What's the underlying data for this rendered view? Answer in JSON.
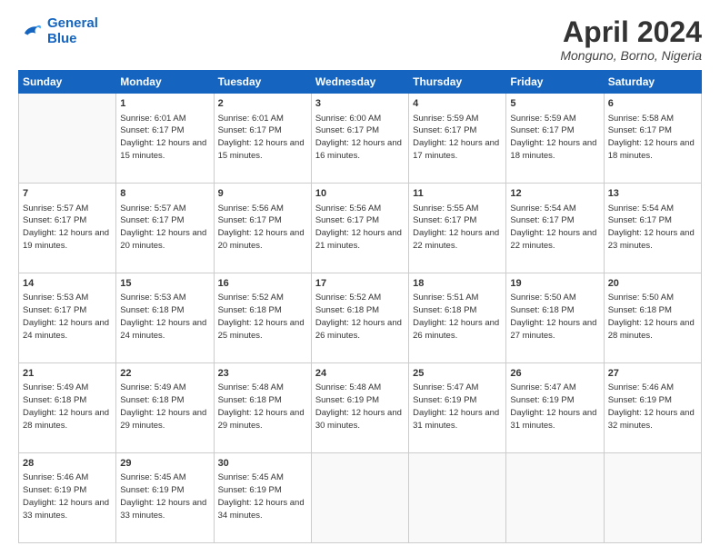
{
  "logo": {
    "line1": "General",
    "line2": "Blue"
  },
  "title": "April 2024",
  "location": "Monguno, Borno, Nigeria",
  "weekdays": [
    "Sunday",
    "Monday",
    "Tuesday",
    "Wednesday",
    "Thursday",
    "Friday",
    "Saturday"
  ],
  "weeks": [
    [
      {
        "day": null,
        "sunrise": null,
        "sunset": null,
        "daylight": null
      },
      {
        "day": "1",
        "sunrise": "6:01 AM",
        "sunset": "6:17 PM",
        "daylight": "12 hours and 15 minutes."
      },
      {
        "day": "2",
        "sunrise": "6:01 AM",
        "sunset": "6:17 PM",
        "daylight": "12 hours and 15 minutes."
      },
      {
        "day": "3",
        "sunrise": "6:00 AM",
        "sunset": "6:17 PM",
        "daylight": "12 hours and 16 minutes."
      },
      {
        "day": "4",
        "sunrise": "5:59 AM",
        "sunset": "6:17 PM",
        "daylight": "12 hours and 17 minutes."
      },
      {
        "day": "5",
        "sunrise": "5:59 AM",
        "sunset": "6:17 PM",
        "daylight": "12 hours and 18 minutes."
      },
      {
        "day": "6",
        "sunrise": "5:58 AM",
        "sunset": "6:17 PM",
        "daylight": "12 hours and 18 minutes."
      }
    ],
    [
      {
        "day": "7",
        "sunrise": "5:57 AM",
        "sunset": "6:17 PM",
        "daylight": "12 hours and 19 minutes."
      },
      {
        "day": "8",
        "sunrise": "5:57 AM",
        "sunset": "6:17 PM",
        "daylight": "12 hours and 20 minutes."
      },
      {
        "day": "9",
        "sunrise": "5:56 AM",
        "sunset": "6:17 PM",
        "daylight": "12 hours and 20 minutes."
      },
      {
        "day": "10",
        "sunrise": "5:56 AM",
        "sunset": "6:17 PM",
        "daylight": "12 hours and 21 minutes."
      },
      {
        "day": "11",
        "sunrise": "5:55 AM",
        "sunset": "6:17 PM",
        "daylight": "12 hours and 22 minutes."
      },
      {
        "day": "12",
        "sunrise": "5:54 AM",
        "sunset": "6:17 PM",
        "daylight": "12 hours and 22 minutes."
      },
      {
        "day": "13",
        "sunrise": "5:54 AM",
        "sunset": "6:17 PM",
        "daylight": "12 hours and 23 minutes."
      }
    ],
    [
      {
        "day": "14",
        "sunrise": "5:53 AM",
        "sunset": "6:17 PM",
        "daylight": "12 hours and 24 minutes."
      },
      {
        "day": "15",
        "sunrise": "5:53 AM",
        "sunset": "6:18 PM",
        "daylight": "12 hours and 24 minutes."
      },
      {
        "day": "16",
        "sunrise": "5:52 AM",
        "sunset": "6:18 PM",
        "daylight": "12 hours and 25 minutes."
      },
      {
        "day": "17",
        "sunrise": "5:52 AM",
        "sunset": "6:18 PM",
        "daylight": "12 hours and 26 minutes."
      },
      {
        "day": "18",
        "sunrise": "5:51 AM",
        "sunset": "6:18 PM",
        "daylight": "12 hours and 26 minutes."
      },
      {
        "day": "19",
        "sunrise": "5:50 AM",
        "sunset": "6:18 PM",
        "daylight": "12 hours and 27 minutes."
      },
      {
        "day": "20",
        "sunrise": "5:50 AM",
        "sunset": "6:18 PM",
        "daylight": "12 hours and 28 minutes."
      }
    ],
    [
      {
        "day": "21",
        "sunrise": "5:49 AM",
        "sunset": "6:18 PM",
        "daylight": "12 hours and 28 minutes."
      },
      {
        "day": "22",
        "sunrise": "5:49 AM",
        "sunset": "6:18 PM",
        "daylight": "12 hours and 29 minutes."
      },
      {
        "day": "23",
        "sunrise": "5:48 AM",
        "sunset": "6:18 PM",
        "daylight": "12 hours and 29 minutes."
      },
      {
        "day": "24",
        "sunrise": "5:48 AM",
        "sunset": "6:19 PM",
        "daylight": "12 hours and 30 minutes."
      },
      {
        "day": "25",
        "sunrise": "5:47 AM",
        "sunset": "6:19 PM",
        "daylight": "12 hours and 31 minutes."
      },
      {
        "day": "26",
        "sunrise": "5:47 AM",
        "sunset": "6:19 PM",
        "daylight": "12 hours and 31 minutes."
      },
      {
        "day": "27",
        "sunrise": "5:46 AM",
        "sunset": "6:19 PM",
        "daylight": "12 hours and 32 minutes."
      }
    ],
    [
      {
        "day": "28",
        "sunrise": "5:46 AM",
        "sunset": "6:19 PM",
        "daylight": "12 hours and 33 minutes."
      },
      {
        "day": "29",
        "sunrise": "5:45 AM",
        "sunset": "6:19 PM",
        "daylight": "12 hours and 33 minutes."
      },
      {
        "day": "30",
        "sunrise": "5:45 AM",
        "sunset": "6:19 PM",
        "daylight": "12 hours and 34 minutes."
      },
      {
        "day": null,
        "sunrise": null,
        "sunset": null,
        "daylight": null
      },
      {
        "day": null,
        "sunrise": null,
        "sunset": null,
        "daylight": null
      },
      {
        "day": null,
        "sunrise": null,
        "sunset": null,
        "daylight": null
      },
      {
        "day": null,
        "sunrise": null,
        "sunset": null,
        "daylight": null
      }
    ]
  ],
  "labels": {
    "sunrise": "Sunrise:",
    "sunset": "Sunset:",
    "daylight": "Daylight:"
  }
}
